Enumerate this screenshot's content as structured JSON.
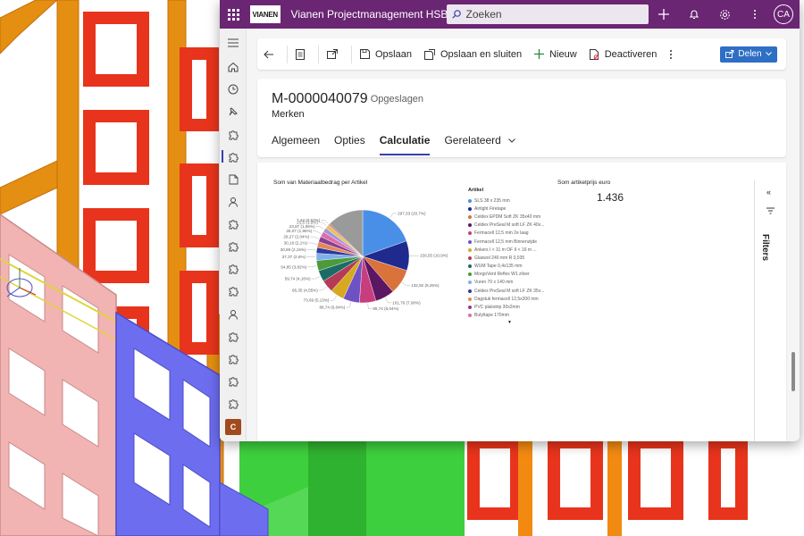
{
  "app": {
    "title": "Vianen Projectmanagement HSB",
    "logo_text": "VIANEN",
    "search_placeholder": "Zoeken",
    "user_initials": "CA",
    "icons": [
      "waffle-icon",
      "search-icon",
      "plus-icon",
      "bell-icon",
      "gear-icon",
      "more-icon"
    ]
  },
  "nav": {
    "icons": [
      "hamburger-icon",
      "home-icon",
      "recent-icon",
      "pin-icon",
      "puzzle-icon",
      "puzzle-icon",
      "document-icon",
      "person-icon",
      "puzzle-icon",
      "puzzle-icon",
      "puzzle-icon",
      "puzzle-icon",
      "person-icon",
      "puzzle-icon",
      "puzzle-icon",
      "puzzle-icon",
      "puzzle-icon"
    ],
    "area_letter": "C"
  },
  "commandbar": {
    "save": "Opslaan",
    "save_close": "Opslaan en sluiten",
    "new": "Nieuw",
    "deactivate": "Deactiveren",
    "share": "Delen"
  },
  "record": {
    "id": "M-0000040079",
    "status": "- Opgeslagen",
    "entity": "Merken"
  },
  "tabs": [
    {
      "label": "Algemeen",
      "active": false
    },
    {
      "label": "Opties",
      "active": false
    },
    {
      "label": "Calculatie",
      "active": true
    },
    {
      "label": "Gerelateerd",
      "active": false
    }
  ],
  "card": {
    "title": "Som artikelprijs euro",
    "value": "1.436"
  },
  "filters_label": "Filters",
  "chart_data": {
    "type": "pie",
    "title": "Som van Materiaalbedrag per Artikel",
    "legend_title": "Artikel",
    "legend_position": "right",
    "legend": [
      {
        "name": "SLS 38 x 235 mm",
        "color": "#4a8fe7"
      },
      {
        "name": "Airtight Firetape",
        "color": "#1f2a8f"
      },
      {
        "name": "Celdex EPDM Soft ZK 35x40 mm",
        "color": "#d9723b"
      },
      {
        "name": "Celdex PreSeal M soft LF ZK 40x...",
        "color": "#5c1763"
      },
      {
        "name": "Fermacell 12,5 mm 2e laag",
        "color": "#c83d7d"
      },
      {
        "name": "Fermacell 12,5 mm Binnenzijde",
        "color": "#6e52c5"
      },
      {
        "name": "Ankers I  <  11 m OF II  <  16 m ...",
        "color": "#d6a91f"
      },
      {
        "name": "Glaswol 240 mm R 0,035",
        "color": "#b53b54"
      },
      {
        "name": "WUM Tape 0,4x135 mm",
        "color": "#1b6b67"
      },
      {
        "name": "MorgoVent Reflex W1 zilver",
        "color": "#4b9b3a"
      },
      {
        "name": "Vuren 70 x 140 mm",
        "color": "#7fb0eb"
      },
      {
        "name": "Celdex PreSeal M soft LF ZK 35x...",
        "color": "#2e3a9f"
      },
      {
        "name": "Dagstuk fermacell 12,5x200 mm",
        "color": "#e38a55"
      },
      {
        "name": "PVC plakstrip 30x2mm",
        "color": "#8d3f94"
      },
      {
        "name": "Butyltape 170mm",
        "color": "#dd6ea6"
      }
    ],
    "slices": [
      {
        "value": 297.33,
        "percent": 20.7,
        "label": "297,33 (20,7%)",
        "color": "#4a8fe7"
      },
      {
        "value": 156.55,
        "percent": 10.9,
        "label": "156,55 (10,9%)",
        "color": "#1f2a8f"
      },
      {
        "value": 132.92,
        "percent": 9.25,
        "label": "132,92 (9,25%)",
        "color": "#d9723b"
      },
      {
        "value": 101.76,
        "percent": 7.08,
        "label": "101,76 (7,08%)",
        "color": "#5c1763"
      },
      {
        "value": 86.74,
        "percent": 6.04,
        "label": "86,74 (6,04%)",
        "color": "#c83d7d"
      },
      {
        "value": 86.74,
        "percent": 6.04,
        "label": "86,74 (6,04%)",
        "color": "#6e52c5"
      },
      {
        "value": 73.69,
        "percent": 5.13,
        "label": "73,69 (5,13%)",
        "color": "#d6a91f"
      },
      {
        "value": 65.35,
        "percent": 4.55,
        "label": "65,35 (4,55%)",
        "color": "#b53b54"
      },
      {
        "value": 59.74,
        "percent": 4.16,
        "label": "59,74 (4,16%)",
        "color": "#1b6b67"
      },
      {
        "value": 54.85,
        "percent": 3.82,
        "label": "54,85 (3,82%)",
        "color": "#4b9b3a"
      },
      {
        "value": 37.37,
        "percent": 2.6,
        "label": "37,37 (2,6%)",
        "color": "#7fb0eb"
      },
      {
        "value": 30.89,
        "percent": 2.15,
        "label": "30,89 (2,15%)",
        "color": "#2e3a9f"
      },
      {
        "value": 30.16,
        "percent": 2.1,
        "label": "30,16 (2,1%)",
        "color": "#e38a55"
      },
      {
        "value": 29.27,
        "percent": 2.04,
        "label": "29,27 (2,04%)",
        "color": "#8d3f94"
      },
      {
        "value": 28.07,
        "percent": 1.95,
        "label": "28,07 (1,95%)",
        "color": "#dd6ea6"
      },
      {
        "value": 23.87,
        "percent": 1.66,
        "label": "23,87 (1,66%)",
        "color": "#a495e0"
      },
      {
        "value": 21.5,
        "percent": 1.5,
        "label": "21,5 (1,5%)",
        "color": "#e8c25a"
      },
      {
        "value": 7.44,
        "percent": 0.52,
        "label": "7,44 (0,52%)",
        "color": "#cf6d86"
      },
      {
        "value": 191.58,
        "percent": 13.34,
        "color": "#9a9a9a"
      }
    ]
  }
}
